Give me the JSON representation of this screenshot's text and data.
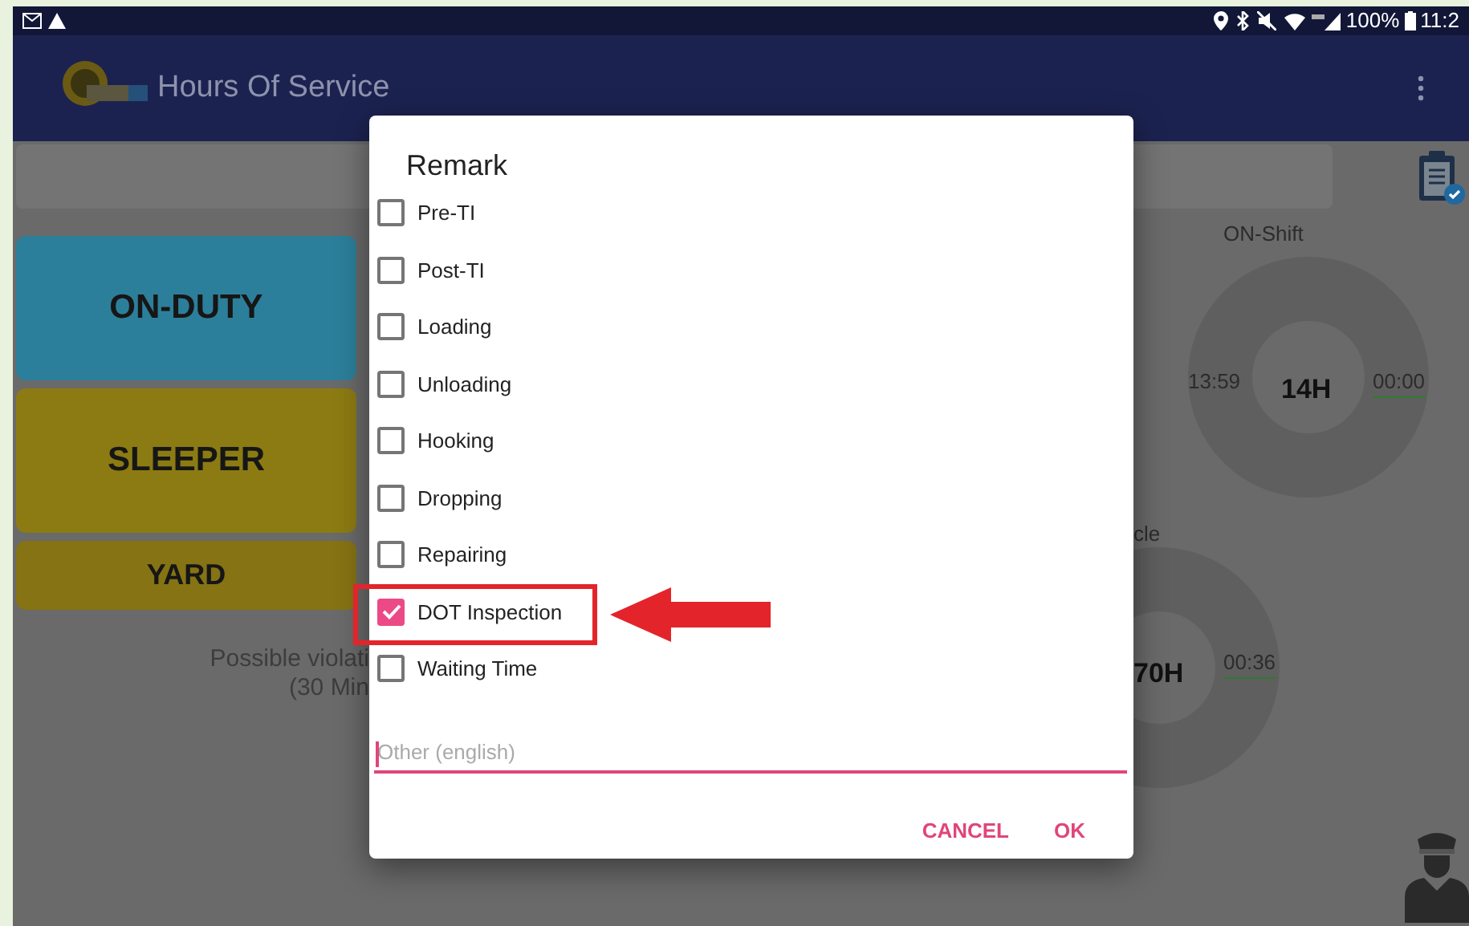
{
  "status_bar": {
    "battery": "100%",
    "time": "11:2"
  },
  "app_bar": {
    "title": "Hours Of Service"
  },
  "background": {
    "duty_buttons": [
      {
        "label": "ON-DUTY",
        "color": "#2c7f9a",
        "kind": "tall"
      },
      {
        "label": "SLEEPER",
        "color": "#8c7b12",
        "kind": "tall"
      },
      {
        "label": "YARD",
        "color": "#857314",
        "kind": "short"
      }
    ],
    "violation_text": [
      "Possible violati",
      "(30 Min"
    ],
    "on_shift": {
      "title": "ON-Shift",
      "left": "13:59",
      "center": "14H",
      "right": "00:00"
    },
    "cycle": {
      "title": "cle",
      "center": "70H",
      "right": "00:36"
    }
  },
  "dialog": {
    "title": "Remark",
    "options": [
      {
        "label": "Pre-TI",
        "checked": false
      },
      {
        "label": "Post-TI",
        "checked": false
      },
      {
        "label": "Loading",
        "checked": false
      },
      {
        "label": "Unloading",
        "checked": false
      },
      {
        "label": "Hooking",
        "checked": false
      },
      {
        "label": "Dropping",
        "checked": false
      },
      {
        "label": "Repairing",
        "checked": false
      },
      {
        "label": "DOT Inspection",
        "checked": true
      },
      {
        "label": "Waiting Time",
        "checked": false
      }
    ],
    "other": {
      "placeholder": "Other (english)"
    },
    "buttons": [
      "CANCEL",
      "OK"
    ]
  }
}
